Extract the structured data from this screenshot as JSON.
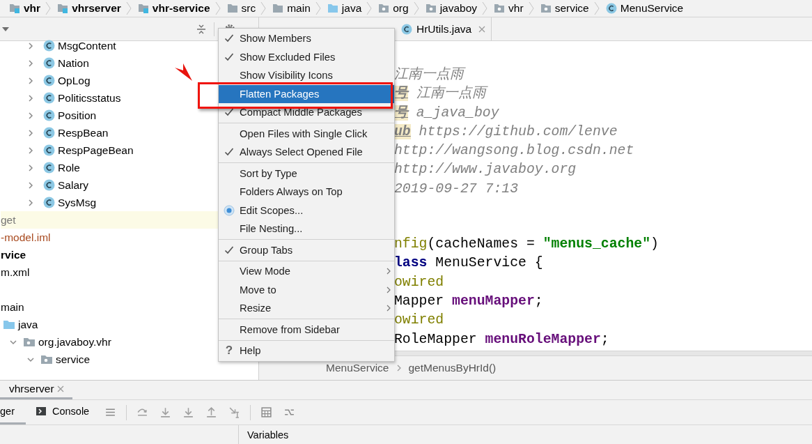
{
  "breadcrumb": [
    {
      "label": "vhr",
      "kind": "module"
    },
    {
      "label": "vhrserver",
      "kind": "module"
    },
    {
      "label": "vhr-service",
      "kind": "module"
    },
    {
      "label": "src",
      "kind": "folder"
    },
    {
      "label": "main",
      "kind": "folder"
    },
    {
      "label": "java",
      "kind": "source"
    },
    {
      "label": "org",
      "kind": "package"
    },
    {
      "label": "javaboy",
      "kind": "package"
    },
    {
      "label": "vhr",
      "kind": "package"
    },
    {
      "label": "service",
      "kind": "package"
    },
    {
      "label": "MenuService",
      "kind": "class"
    }
  ],
  "project_panel": {
    "tree": [
      {
        "label": "MsgContent",
        "kind": "class",
        "expanded": false
      },
      {
        "label": "Nation",
        "kind": "class",
        "expanded": false
      },
      {
        "label": "OpLog",
        "kind": "class",
        "expanded": false
      },
      {
        "label": "Politicsstatus",
        "kind": "class",
        "expanded": false
      },
      {
        "label": "Position",
        "kind": "class",
        "expanded": false
      },
      {
        "label": "RespBean",
        "kind": "class",
        "expanded": false
      },
      {
        "label": "RespPageBean",
        "kind": "class",
        "expanded": false
      },
      {
        "label": "Role",
        "kind": "class",
        "expanded": false
      },
      {
        "label": "Salary",
        "kind": "class",
        "expanded": false
      },
      {
        "label": "SysMsg",
        "kind": "class",
        "expanded": false
      },
      {
        "label": "get",
        "kind": "excluded-folder"
      },
      {
        "label": "-model.iml",
        "kind": "module-file"
      },
      {
        "label": "rvice",
        "kind": "module"
      },
      {
        "label": "m.xml",
        "kind": "file"
      },
      {
        "label": "main",
        "kind": "folder",
        "children": [
          {
            "label": "java",
            "kind": "source-root",
            "children": [
              {
                "label": "org.javaboy.vhr",
                "kind": "package",
                "expanded": true,
                "children": [
                  {
                    "label": "service",
                    "kind": "package",
                    "expanded": true
                  }
                ]
              }
            ]
          }
        ]
      }
    ]
  },
  "editor": {
    "tabs": [
      {
        "label": "HrUtils.java"
      }
    ],
    "doc_comment": [
      {
        "segments": [
          {
            "text": "江南一点雨",
            "kind": "comment"
          }
        ]
      },
      {
        "segments": [
          {
            "text": "号",
            "kind": "tag"
          },
          {
            "text": " 江南一点雨",
            "kind": "comment"
          }
        ]
      },
      {
        "segments": [
          {
            "text": "号",
            "kind": "tag"
          },
          {
            "text": " a_java_boy",
            "kind": "comment"
          }
        ]
      },
      {
        "segments": [
          {
            "text": "ub",
            "kind": "tag"
          },
          {
            "text": " https://github.com/lenve",
            "kind": "comment"
          }
        ]
      },
      {
        "segments": [
          {
            "text": "http://wangsong.blog.csdn.net",
            "kind": "comment"
          }
        ]
      },
      {
        "segments": [
          {
            "text": "http://www.javaboy.org",
            "kind": "comment"
          }
        ]
      },
      {
        "segments": [
          {
            "text": "2019-09-27 7:13",
            "kind": "comment"
          }
        ]
      }
    ],
    "code": [
      {
        "segments": [
          {
            "text": "nfig",
            "kind": "annotation"
          },
          {
            "text": "(cacheNames = ",
            "kind": "plain"
          },
          {
            "text": "\"menus_cache\"",
            "kind": "string"
          },
          {
            "text": ")",
            "kind": "plain"
          }
        ]
      },
      {
        "segments": [
          {
            "text": "lass",
            "kind": "keyword"
          },
          {
            "text": " MenuService {",
            "kind": "plain"
          }
        ]
      },
      {
        "segments": [
          {
            "text": "owired",
            "kind": "annotation"
          }
        ]
      },
      {
        "segments": [
          {
            "text": "Mapper ",
            "kind": "plain"
          },
          {
            "text": "menuMapper",
            "kind": "field"
          },
          {
            "text": ";",
            "kind": "plain"
          }
        ]
      },
      {
        "segments": [
          {
            "text": "owired",
            "kind": "annotation"
          }
        ]
      },
      {
        "segments": [
          {
            "text": "RoleMapper ",
            "kind": "plain"
          },
          {
            "text": "menuRoleMapper",
            "kind": "field"
          },
          {
            "text": ";",
            "kind": "plain"
          }
        ]
      }
    ],
    "breadcrumb": [
      "MenuService",
      "getMenusByHrId()"
    ]
  },
  "context_menu": {
    "groups": [
      [
        {
          "label": "Show Members",
          "kind": "check",
          "checked": true,
          "selected": false
        },
        {
          "label": "Show Excluded Files",
          "kind": "check",
          "checked": true,
          "selected": false
        },
        {
          "label": "Show Visibility Icons",
          "kind": "check",
          "checked": false,
          "selected": false
        },
        {
          "label": "Flatten Packages",
          "kind": "check",
          "checked": false,
          "selected": true
        },
        {
          "label": "Compact Middle Packages",
          "kind": "check",
          "checked": true,
          "selected": false
        }
      ],
      [
        {
          "label": "Open Files with Single Click",
          "kind": "check",
          "checked": false,
          "selected": false
        },
        {
          "label": "Always Select Opened File",
          "kind": "check",
          "checked": true,
          "selected": false
        }
      ],
      [
        {
          "label": "Sort by Type",
          "kind": "check",
          "checked": false,
          "selected": false
        },
        {
          "label": "Folders Always on Top",
          "kind": "check",
          "checked": false,
          "selected": false
        },
        {
          "label": "Edit Scopes...",
          "kind": "radio",
          "checked": true,
          "selected": false
        },
        {
          "label": "File Nesting...",
          "kind": "action",
          "selected": false
        }
      ],
      [
        {
          "label": "Group Tabs",
          "kind": "check",
          "checked": true,
          "selected": false
        }
      ],
      [
        {
          "label": "View Mode",
          "kind": "submenu",
          "selected": false
        },
        {
          "label": "Move to",
          "kind": "submenu",
          "selected": false
        },
        {
          "label": "Resize",
          "kind": "submenu",
          "selected": false
        }
      ],
      [
        {
          "label": "Remove from Sidebar",
          "kind": "action",
          "selected": false
        }
      ],
      [
        {
          "label": "Help",
          "kind": "help",
          "icon": "?",
          "selected": false
        }
      ]
    ]
  },
  "tool_window": {
    "tabs": [
      {
        "label": "vhrserver",
        "selected": true
      }
    ],
    "subtabs": [
      {
        "label": "ger",
        "kind": "text",
        "selected": true
      },
      {
        "label": "Console",
        "kind": "console",
        "selected": false
      }
    ],
    "panes": [
      "Variables"
    ]
  }
}
